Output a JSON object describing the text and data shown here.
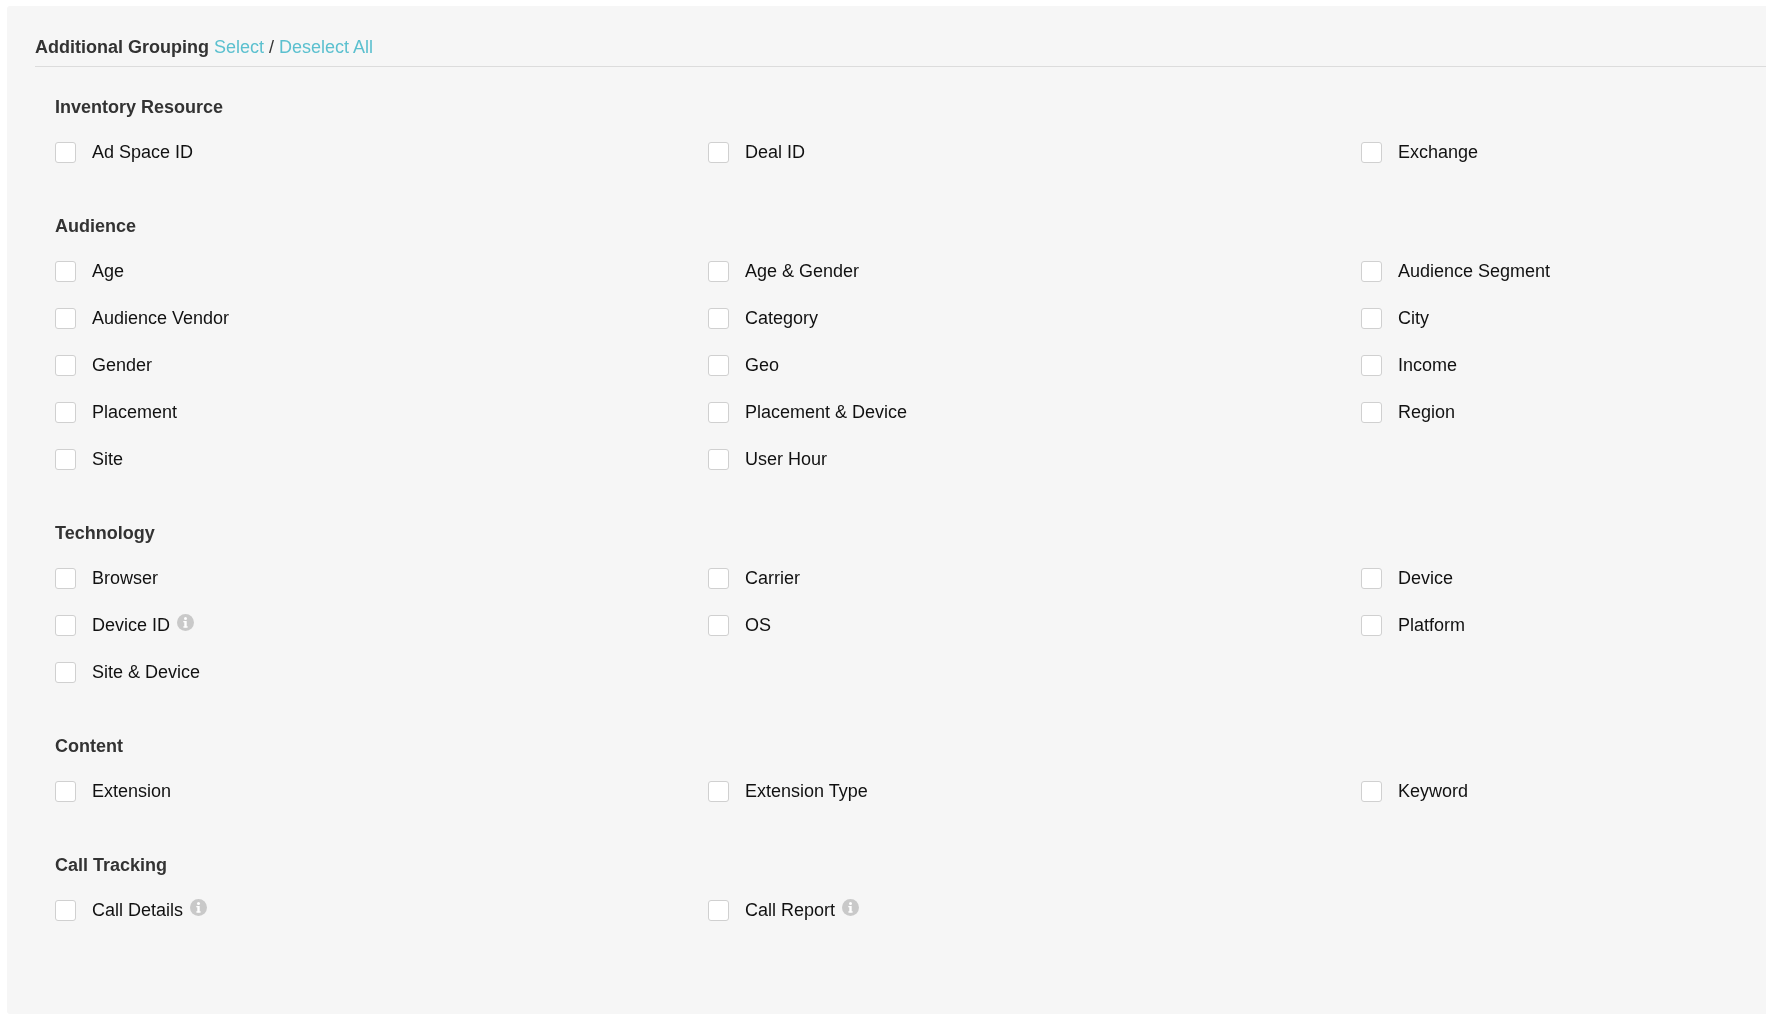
{
  "header": {
    "title": "Additional Grouping",
    "select_link": "Select",
    "separator": "/",
    "deselect_link": "Deselect All"
  },
  "sections": [
    {
      "title": "Inventory Resource",
      "items": [
        {
          "label": "Ad Space ID",
          "checked": false,
          "info": false
        },
        {
          "label": "Deal ID",
          "checked": false,
          "info": false
        },
        {
          "label": "Exchange",
          "checked": false,
          "info": false
        }
      ]
    },
    {
      "title": "Audience",
      "items": [
        {
          "label": "Age",
          "checked": false,
          "info": false
        },
        {
          "label": "Age & Gender",
          "checked": false,
          "info": false
        },
        {
          "label": "Audience Segment",
          "checked": false,
          "info": false
        },
        {
          "label": "Audience Vendor",
          "checked": false,
          "info": false
        },
        {
          "label": "Category",
          "checked": false,
          "info": false
        },
        {
          "label": "City",
          "checked": false,
          "info": false
        },
        {
          "label": "Gender",
          "checked": false,
          "info": false
        },
        {
          "label": "Geo",
          "checked": false,
          "info": false
        },
        {
          "label": "Income",
          "checked": false,
          "info": false
        },
        {
          "label": "Placement",
          "checked": false,
          "info": false
        },
        {
          "label": "Placement & Device",
          "checked": false,
          "info": false
        },
        {
          "label": "Region",
          "checked": false,
          "info": false
        },
        {
          "label": "Site",
          "checked": false,
          "info": false
        },
        {
          "label": "User Hour",
          "checked": false,
          "info": false
        }
      ]
    },
    {
      "title": "Technology",
      "items": [
        {
          "label": "Browser",
          "checked": false,
          "info": false
        },
        {
          "label": "Carrier",
          "checked": false,
          "info": false
        },
        {
          "label": "Device",
          "checked": false,
          "info": false
        },
        {
          "label": "Device ID",
          "checked": false,
          "info": true
        },
        {
          "label": "OS",
          "checked": false,
          "info": false
        },
        {
          "label": "Platform",
          "checked": false,
          "info": false
        },
        {
          "label": "Site & Device",
          "checked": false,
          "info": false
        }
      ]
    },
    {
      "title": "Content",
      "items": [
        {
          "label": "Extension",
          "checked": false,
          "info": false
        },
        {
          "label": "Extension Type",
          "checked": false,
          "info": false
        },
        {
          "label": "Keyword",
          "checked": false,
          "info": false
        }
      ]
    },
    {
      "title": "Call Tracking",
      "items": [
        {
          "label": "Call Details",
          "checked": false,
          "info": true
        },
        {
          "label": "Call Report",
          "checked": false,
          "info": true
        }
      ]
    }
  ]
}
